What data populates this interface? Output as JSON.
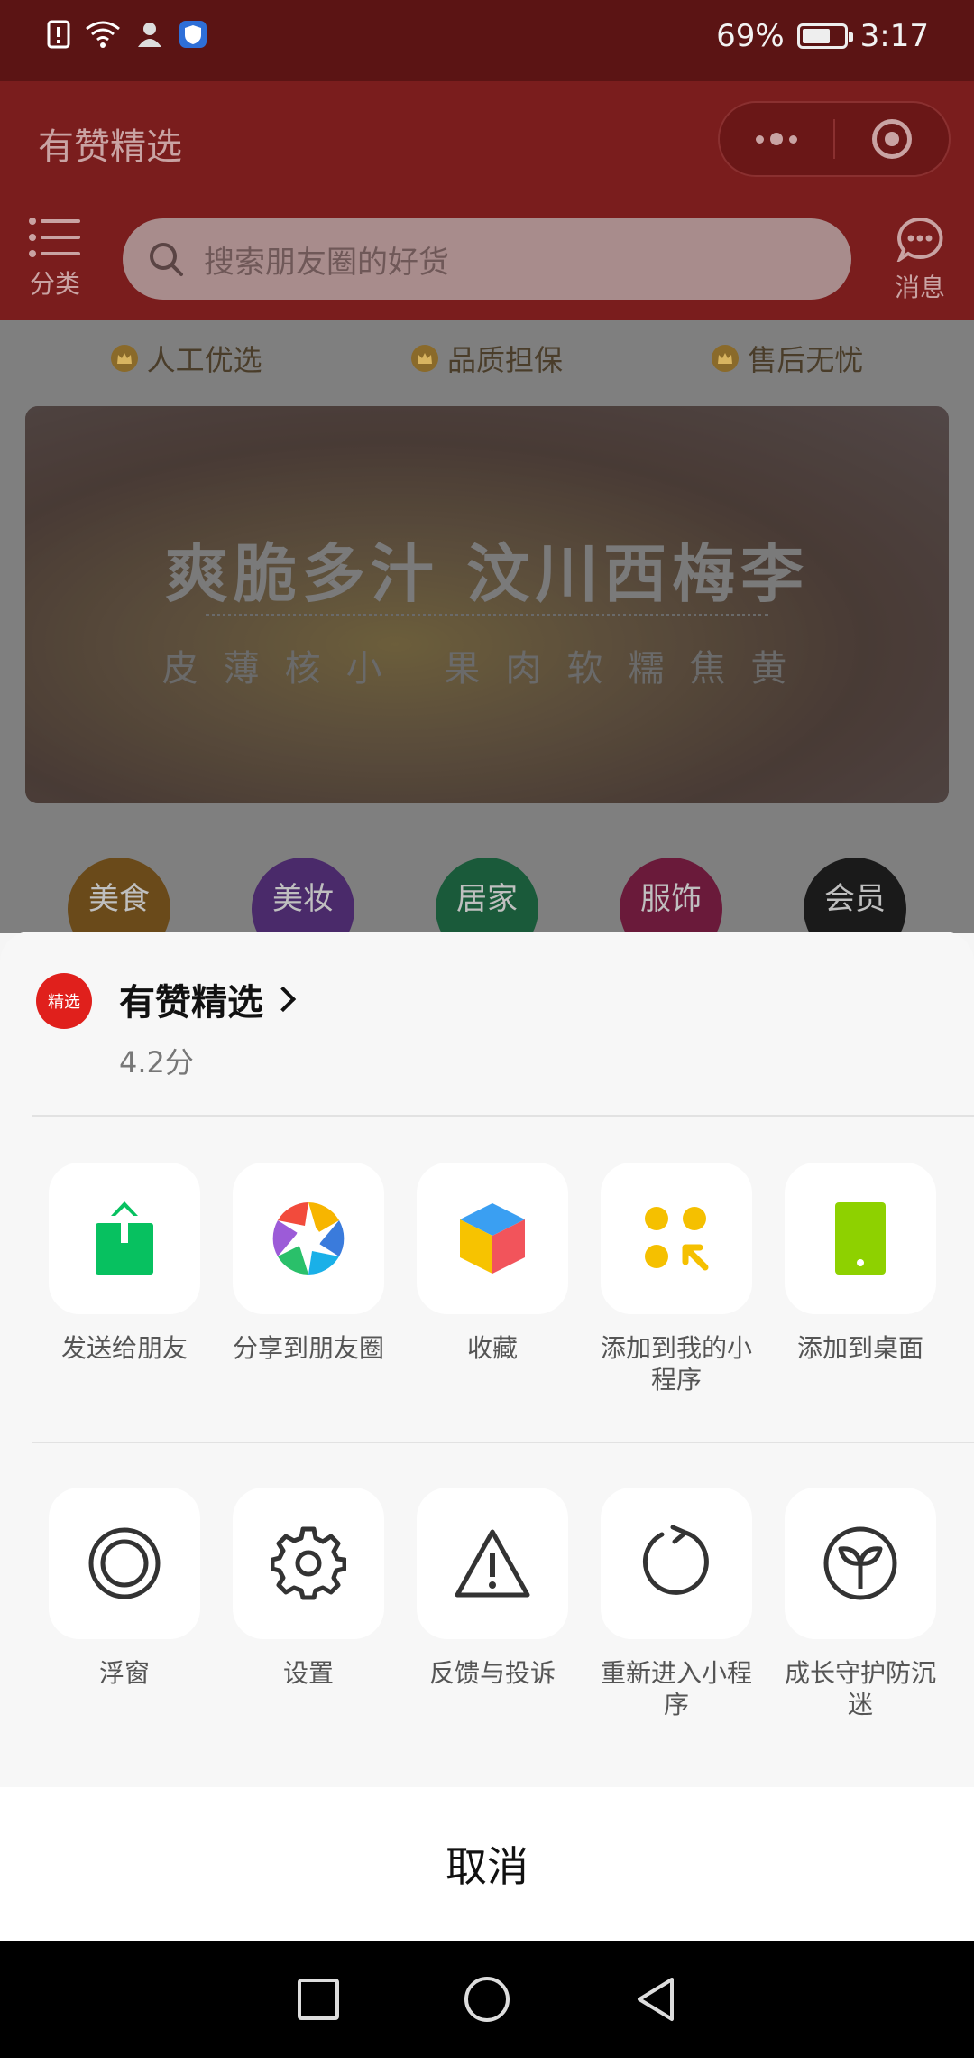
{
  "status": {
    "battery": "69%",
    "time": "3:17",
    "battery_level": 0.69
  },
  "header": {
    "title": "有赞精选",
    "category_label": "分类",
    "search_placeholder": "搜索朋友圈的好货",
    "message_label": "消息"
  },
  "badges": [
    "人工优选",
    "品质担保",
    "售后无忧"
  ],
  "banner": {
    "title": "爽脆多汁 汶川西梅李",
    "subtitle": "皮薄核小 果肉软糯焦黄"
  },
  "categories": [
    {
      "label": "美食",
      "color": "#6a4a1a"
    },
    {
      "label": "美妆",
      "color": "#4a2a6a"
    },
    {
      "label": "居家",
      "color": "#1a5a3a"
    },
    {
      "label": "服饰",
      "color": "#6a1a3a"
    },
    {
      "label": "会员",
      "color": "#1a1a1a"
    }
  ],
  "sheet": {
    "app_name": "有赞精选",
    "app_logo_text": "精选",
    "score": "4.2分",
    "row1": [
      {
        "label": "发送给朋友",
        "icon": "send-to-friend-icon"
      },
      {
        "label": "分享到朋友圈",
        "icon": "moments-icon"
      },
      {
        "label": "收藏",
        "icon": "favorite-cube-icon"
      },
      {
        "label": "添加到我的小程序",
        "icon": "add-mini-program-icon"
      },
      {
        "label": "添加到桌面",
        "icon": "add-desktop-icon"
      }
    ],
    "row2": [
      {
        "label": "浮窗",
        "icon": "float-window-icon"
      },
      {
        "label": "设置",
        "icon": "settings-gear-icon"
      },
      {
        "label": "反馈与投诉",
        "icon": "warning-icon"
      },
      {
        "label": "重新进入小程序",
        "icon": "reload-icon"
      },
      {
        "label": "成长守护防沉迷",
        "icon": "sprout-icon"
      }
    ],
    "cancel": "取消"
  },
  "colors": {
    "brand_red": "#e0201c",
    "share_green": "#07c160",
    "mini_yellow": "#f5c000",
    "desktop_green": "#8ed100"
  }
}
